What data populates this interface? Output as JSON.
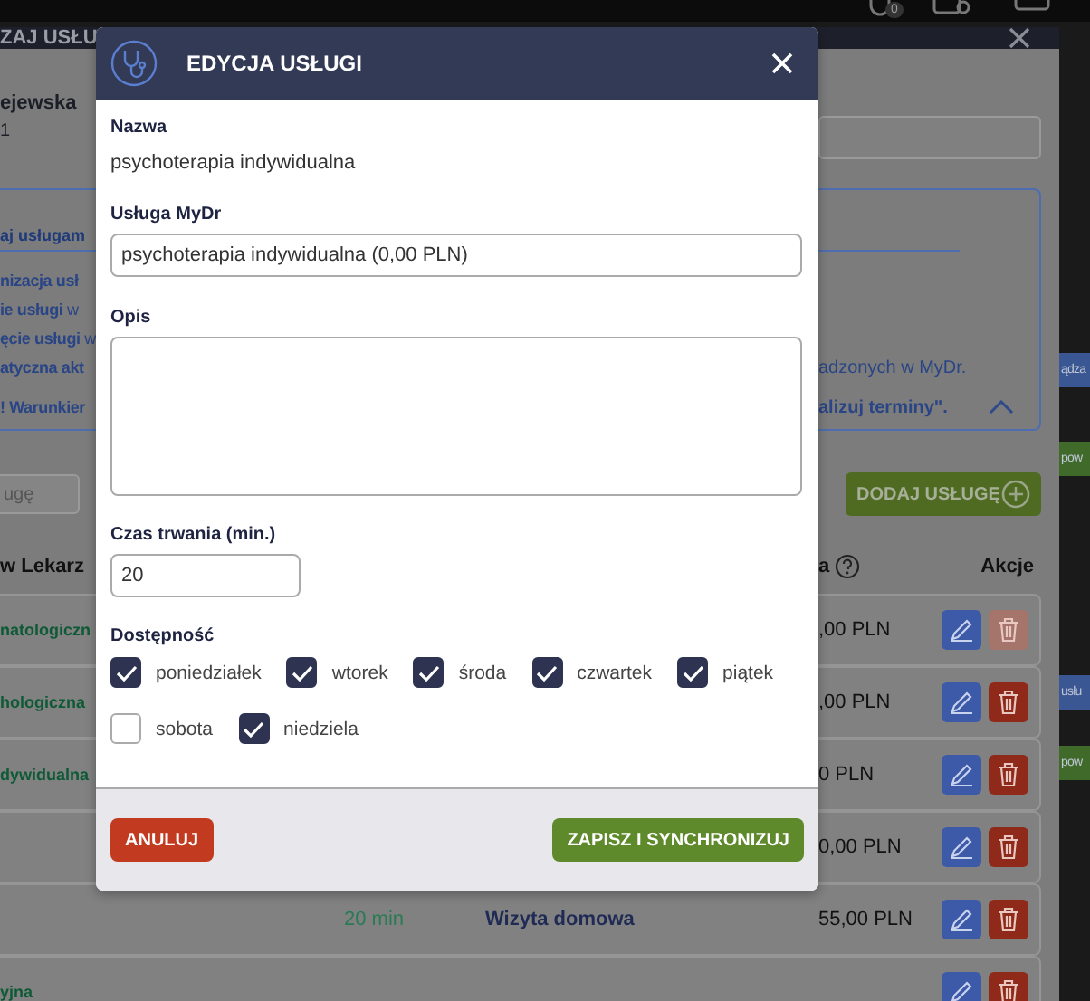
{
  "top_bar": {
    "badge": "0"
  },
  "background_dialog": {
    "title": "ZAJ USŁU",
    "doctor": {
      "name": "ejewska",
      "line_2": "1"
    },
    "info_panel": {
      "title": "aj usługam",
      "expanded": true,
      "lines": [
        {
          "left": "**nizacja usł**"
        },
        {
          "left": "**ie usługi** w"
        },
        {
          "left": "**ęcie usługi** w"
        },
        {
          "left": "**atyczna akt**",
          "right": "adzonych w MyDr."
        },
        {
          "left": "**! Warunkier**",
          "right": "**alizuj terminy\".**"
        }
      ]
    },
    "search": {
      "placeholder": "ugę"
    },
    "add_button": "DODAJ USŁUGĘ",
    "columns": [
      "w Lekarz",
      "a",
      "Akcje"
    ],
    "rows": [
      {
        "column_1": "natologiczn",
        "price": ",00 PLN",
        "delete_disabled": true
      },
      {
        "column_1": "hologiczna",
        "price": ",00 PLN",
        "delete_disabled": false
      },
      {
        "column_1": "dywidualna",
        "price": "0 PLN",
        "delete_disabled": false
      },
      {
        "price": "0,00 PLN",
        "delete_disabled": false
      },
      {
        "duration": "20 min",
        "name": "Wizyta domowa",
        "price": "55,00 PLN",
        "delete_disabled": false
      },
      {
        "column_1": "yjna",
        "delete_disabled": false
      }
    ]
  },
  "side_buttons": [
    {
      "label": "ądza",
      "color": "#3a5794"
    },
    {
      "label": "pow",
      "color": "#3f6a2a"
    },
    {
      "label": "usłu",
      "color": "#3a5794"
    },
    {
      "label": "pow",
      "color": "#3f6a2a"
    }
  ],
  "dialog": {
    "title": "EDYCJA USŁUGI",
    "name_label": "Nazwa",
    "name_value": "psychoterapia indywidualna",
    "service_label": "Usługa MyDr",
    "service_value": "psychoterapia indywidualna (0,00 PLN)",
    "description_label": "Opis",
    "duration_label": "Czas trwania (min.)",
    "duration_value": "20",
    "availability_label": "Dostępność",
    "days": [
      {
        "label": "poniedziałek",
        "checked": true
      },
      {
        "label": "wtorek",
        "checked": true
      },
      {
        "label": "środa",
        "checked": true
      },
      {
        "label": "czwartek",
        "checked": true
      },
      {
        "label": "piątek",
        "checked": true
      },
      {
        "label": "sobota",
        "checked": false
      },
      {
        "label": "niedziela",
        "checked": true
      }
    ],
    "cancel_button": "ANULUJ",
    "save_button": "ZAPISZ I SYNCHRONIZUJ"
  }
}
